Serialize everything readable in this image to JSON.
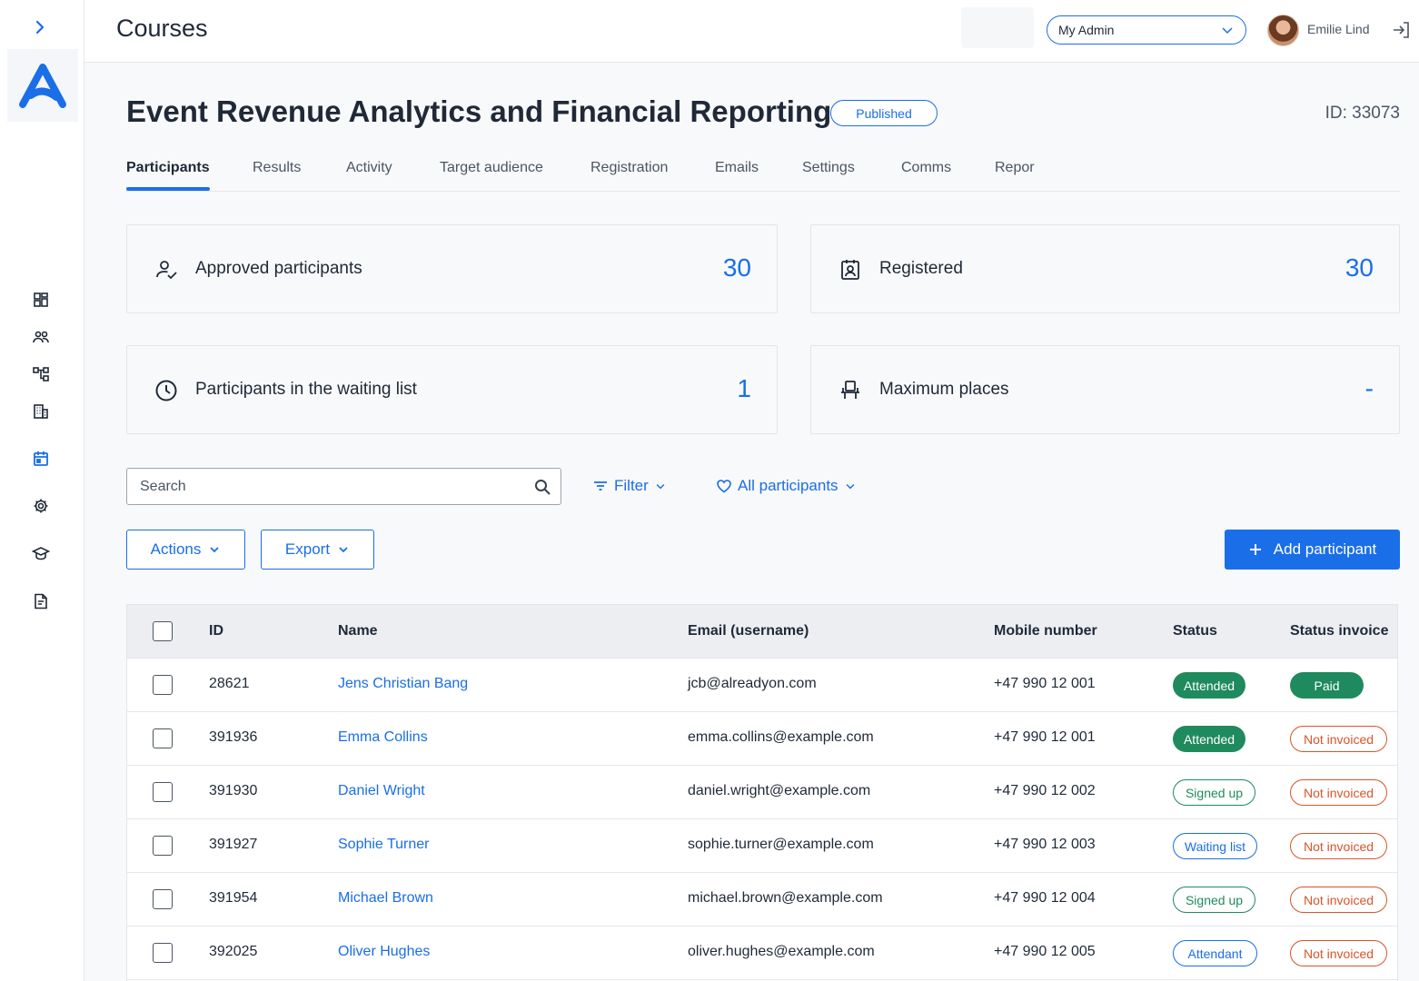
{
  "app": {
    "title": "Courses"
  },
  "header": {
    "admin_select": "My Admin",
    "user_name": "Emilie Lind"
  },
  "course": {
    "title": "Event Revenue Analytics and Financial Reporting",
    "status": "Published",
    "id_label": "ID: 33073"
  },
  "tabs": [
    {
      "label": "Participants"
    },
    {
      "label": "Results"
    },
    {
      "label": "Activity"
    },
    {
      "label": "Target audience"
    },
    {
      "label": "Registration"
    },
    {
      "label": "Emails"
    },
    {
      "label": "Settings"
    },
    {
      "label": "Comms"
    },
    {
      "label": "Repor"
    }
  ],
  "stats": {
    "approved": {
      "label": "Approved participants",
      "value": "30",
      "icon": "user-check-icon"
    },
    "registered": {
      "label": "Registered",
      "value": "30",
      "icon": "badge-icon"
    },
    "waiting": {
      "label": "Participants in the waiting list",
      "value": "1",
      "icon": "clock-icon"
    },
    "max_places": {
      "label": "Maximum places",
      "value": "-",
      "icon": "seat-icon"
    }
  },
  "toolbar": {
    "search_placeholder": "Search",
    "filter_label": "Filter",
    "all_participants_label": "All participants",
    "actions_label": "Actions",
    "export_label": "Export",
    "add_participant_label": "Add participant"
  },
  "table": {
    "columns": {
      "id": "ID",
      "name": "Name",
      "email": "Email (username)",
      "mobile": "Mobile number",
      "status": "Status",
      "invoice": "Status invoice"
    },
    "rows": [
      {
        "id": "28621",
        "name": "Jens Christian Bang",
        "email": "jcb@alreadyon.com",
        "mobile": "+47 990 12 001",
        "status": "Attended",
        "invoice": "Paid"
      },
      {
        "id": "391936",
        "name": "Emma Collins",
        "email": "emma.collins@example.com",
        "mobile": "+47 990 12 001",
        "status": "Attended",
        "invoice": "Not invoiced"
      },
      {
        "id": "391930",
        "name": "Daniel Wright",
        "email": "daniel.wright@example.com",
        "mobile": "+47 990 12 002",
        "status": "Signed up",
        "invoice": "Not invoiced"
      },
      {
        "id": "391927",
        "name": "Sophie Turner",
        "email": "sophie.turner@example.com",
        "mobile": "+47 990 12 003",
        "status": "Waiting list",
        "invoice": "Not invoiced"
      },
      {
        "id": "391954",
        "name": "Michael Brown",
        "email": "michael.brown@example.com",
        "mobile": "+47 990 12 004",
        "status": "Signed up",
        "invoice": "Not invoiced"
      },
      {
        "id": "392025",
        "name": "Oliver Hughes",
        "email": "oliver.hughes@example.com",
        "mobile": "+47 990 12 005",
        "status": "Attendant",
        "invoice": "Not invoiced"
      }
    ]
  },
  "colors": {
    "accent": "#1a6ee8",
    "success": "#1f8a5e",
    "warning": "#d9542a"
  },
  "sidebar": {
    "items": [
      {
        "icon": "dashboard-icon"
      },
      {
        "icon": "users-icon"
      },
      {
        "icon": "hierarchy-icon"
      },
      {
        "icon": "building-icon"
      },
      {
        "icon": "calendar-icon"
      },
      {
        "icon": "gear-icon"
      },
      {
        "icon": "graduation-cap-icon"
      },
      {
        "icon": "document-icon"
      }
    ]
  }
}
